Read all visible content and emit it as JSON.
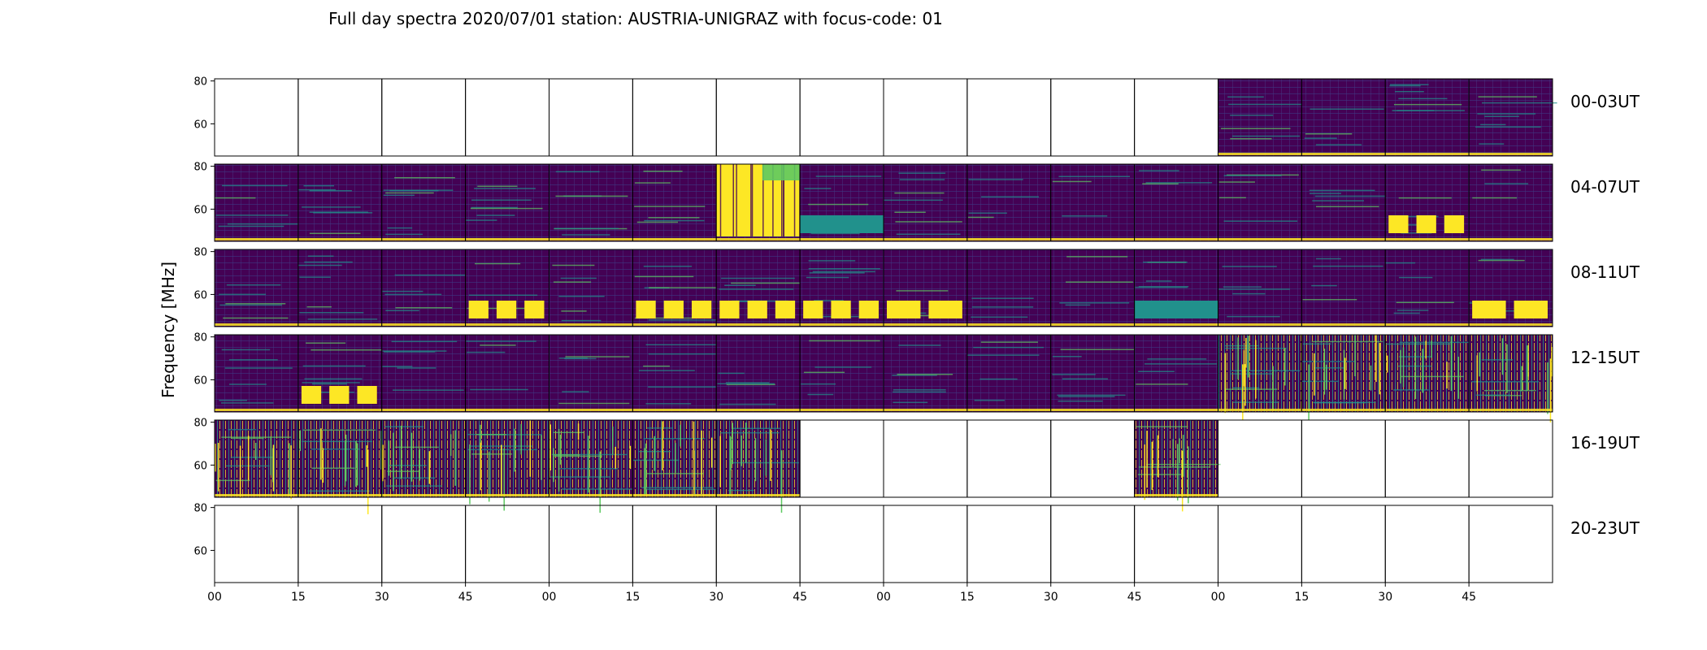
{
  "chart_data": {
    "type": "heatmap",
    "title": "Full day spectra 2020/07/01 station: AUSTRIA-UNIGRAZ with focus-code: 01",
    "ylabel": "Frequency [MHz]",
    "xlabel": "",
    "ylim": [
      45,
      81
    ],
    "y_ticks": [
      "60",
      "80"
    ],
    "x_ticks": [
      "00",
      "15",
      "30",
      "45",
      "00",
      "15",
      "30",
      "45",
      "00",
      "15",
      "30",
      "45",
      "00",
      "15",
      "30",
      "45"
    ],
    "row_labels": [
      "00-03UT",
      "04-07UT",
      "08-11UT",
      "12-15UT",
      "16-19UT",
      "20-23UT"
    ],
    "columns_per_row": 16,
    "minutes_per_panel": 15,
    "colormap": [
      "#440154",
      "#3b528b",
      "#21918c",
      "#5ec962",
      "#fde725"
    ],
    "grid": false,
    "rows": [
      {
        "label": "00-03UT",
        "panels": [
          0,
          0,
          0,
          0,
          0,
          0,
          0,
          0,
          0,
          0,
          0,
          0,
          1,
          1,
          1,
          1
        ]
      },
      {
        "label": "04-07UT",
        "panels": [
          1,
          1,
          1,
          1,
          1,
          1,
          1,
          1,
          1,
          1,
          1,
          1,
          1,
          1,
          1,
          1
        ]
      },
      {
        "label": "08-11UT",
        "panels": [
          1,
          1,
          1,
          1,
          1,
          1,
          1,
          1,
          1,
          1,
          1,
          1,
          1,
          1,
          1,
          1
        ]
      },
      {
        "label": "12-15UT",
        "panels": [
          1,
          1,
          1,
          1,
          1,
          1,
          1,
          1,
          1,
          1,
          1,
          1,
          1,
          1,
          1,
          1
        ]
      },
      {
        "label": "16-19UT",
        "panels": [
          1,
          1,
          1,
          1,
          1,
          1,
          1,
          0,
          0,
          0,
          0,
          1,
          0,
          0,
          0,
          0
        ]
      },
      {
        "label": "20-23UT",
        "panels": [
          0,
          0,
          0,
          0,
          0,
          0,
          0,
          0,
          0,
          0,
          0,
          0,
          0,
          0,
          0,
          0
        ]
      }
    ]
  }
}
